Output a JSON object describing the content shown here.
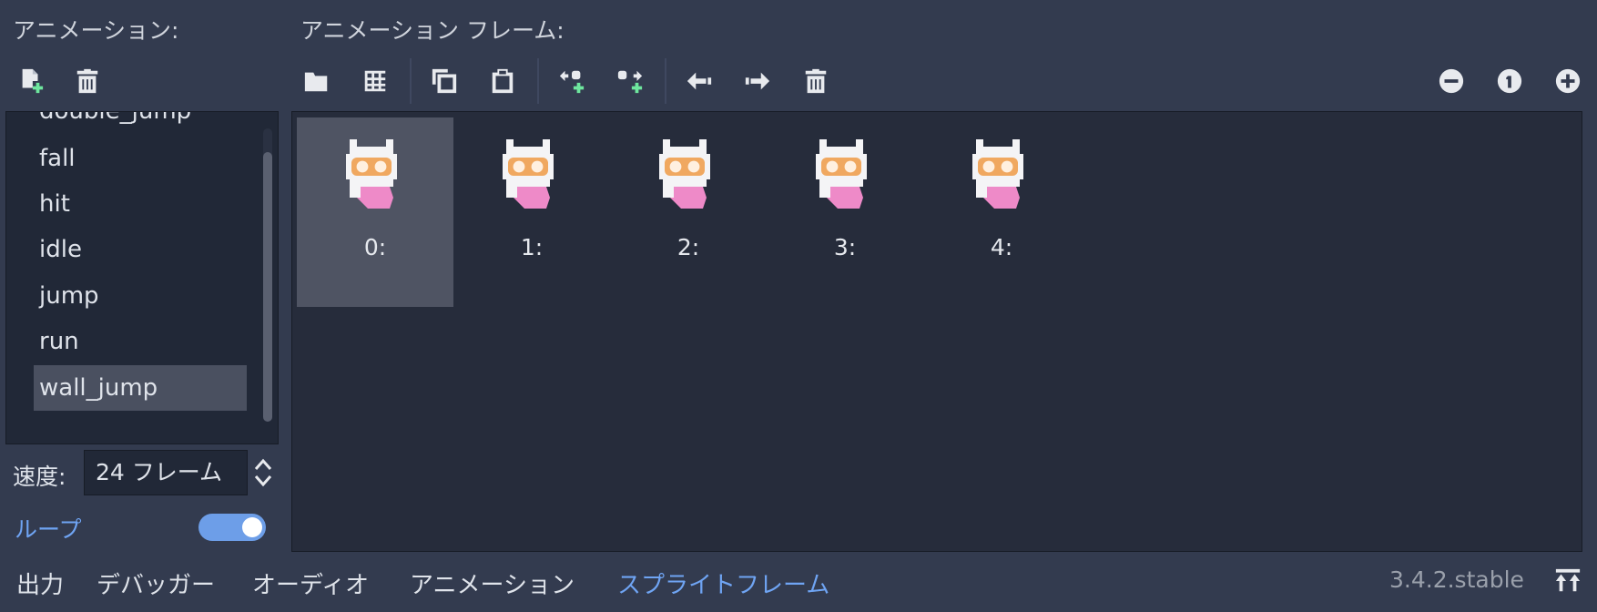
{
  "headers": {
    "animations": "アニメーション:",
    "frames": "アニメーション フレーム:"
  },
  "anim_toolbar": {
    "icons": [
      "new-animation-icon",
      "delete-animation-icon"
    ]
  },
  "frame_toolbar": {
    "icons": [
      "load-folder-icon",
      "spritesheet-grid-icon",
      "copy-icon",
      "paste-icon",
      "insert-before-icon",
      "insert-after-icon",
      "move-left-icon",
      "move-right-icon",
      "delete-frame-icon"
    ],
    "zoom_icons": [
      "zoom-out-icon",
      "zoom-reset-icon",
      "zoom-in-icon"
    ]
  },
  "animations": {
    "items": [
      "double_jump",
      "fall",
      "hit",
      "idle",
      "jump",
      "run",
      "wall_jump"
    ],
    "selected": "wall_jump"
  },
  "frames": {
    "labels": [
      "0:",
      "1:",
      "2:",
      "3:",
      "4:"
    ],
    "selected_index": 0
  },
  "speed": {
    "label": "速度:",
    "value": "24 フレーム"
  },
  "loop": {
    "label": "ループ",
    "enabled": true
  },
  "bottom_tabs": {
    "items": [
      "出力",
      "デバッガー",
      "オーディオ",
      "アニメーション",
      "スプライトフレーム"
    ],
    "active": "スプライトフレーム"
  },
  "version": "3.4.2.stable",
  "colors": {
    "background": "#333b4f",
    "panel": "#262c3b",
    "accent": "#6fa4f3",
    "selection": "#4f5463"
  }
}
